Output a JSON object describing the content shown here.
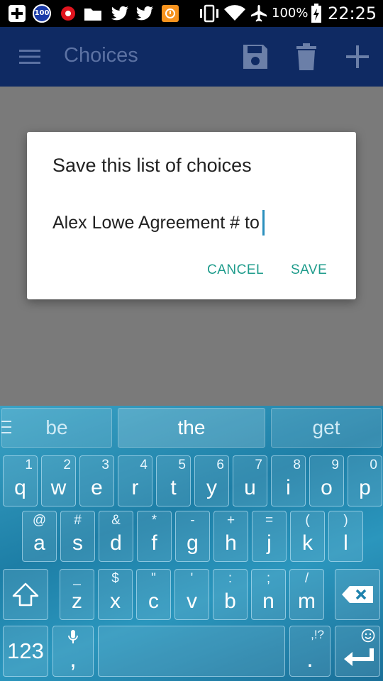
{
  "status_bar": {
    "icons": [
      "plus-box-icon",
      "battery-badge-100-icon",
      "alert-red-icon",
      "folder-icon",
      "twitter-icon",
      "twitter-icon",
      "app-orange-icon",
      "vibrate-icon",
      "wifi-icon",
      "airplane-icon",
      "battery-charging-icon"
    ],
    "badge_text": "100",
    "battery": "100%",
    "time": "22:25"
  },
  "appbar": {
    "title": "Choices",
    "icons": [
      "menu-icon",
      "save-icon",
      "delete-icon",
      "add-icon"
    ],
    "color": "#0f2a63"
  },
  "dialog": {
    "title": "Save this list of choices",
    "input_value": "Alex Lowe Agreement # to",
    "cancel_label": "CANCEL",
    "save_label": "SAVE",
    "accent": "#1f9c8c"
  },
  "keyboard": {
    "suggestions": [
      "be",
      "the",
      "get"
    ],
    "row1": [
      {
        "hint": "1",
        "key": "q"
      },
      {
        "hint": "2",
        "key": "w"
      },
      {
        "hint": "3",
        "key": "e"
      },
      {
        "hint": "4",
        "key": "r"
      },
      {
        "hint": "5",
        "key": "t"
      },
      {
        "hint": "6",
        "key": "y"
      },
      {
        "hint": "7",
        "key": "u"
      },
      {
        "hint": "8",
        "key": "i"
      },
      {
        "hint": "9",
        "key": "o"
      },
      {
        "hint": "0",
        "key": "p"
      }
    ],
    "row2": [
      {
        "hint": "@",
        "key": "a"
      },
      {
        "hint": "#",
        "key": "s"
      },
      {
        "hint": "&",
        "key": "d"
      },
      {
        "hint": "*",
        "key": "f"
      },
      {
        "hint": "-",
        "key": "g"
      },
      {
        "hint": "+",
        "key": "h"
      },
      {
        "hint": "=",
        "key": "j"
      },
      {
        "hint": "(",
        "key": "k"
      },
      {
        "hint": ")",
        "key": "l"
      }
    ],
    "row3": [
      {
        "hint": "_",
        "key": "z"
      },
      {
        "hint": "$",
        "key": "x"
      },
      {
        "hint": "\"",
        "key": "c"
      },
      {
        "hint": "'",
        "key": "v"
      },
      {
        "hint": ":",
        "key": "b"
      },
      {
        "hint": ";",
        "key": "n"
      },
      {
        "hint": "/",
        "key": "m"
      }
    ],
    "numbers_label": "123",
    "comma": ",",
    "period": ".",
    "punct_hint": ",!?",
    "color": "#2b96bd"
  }
}
